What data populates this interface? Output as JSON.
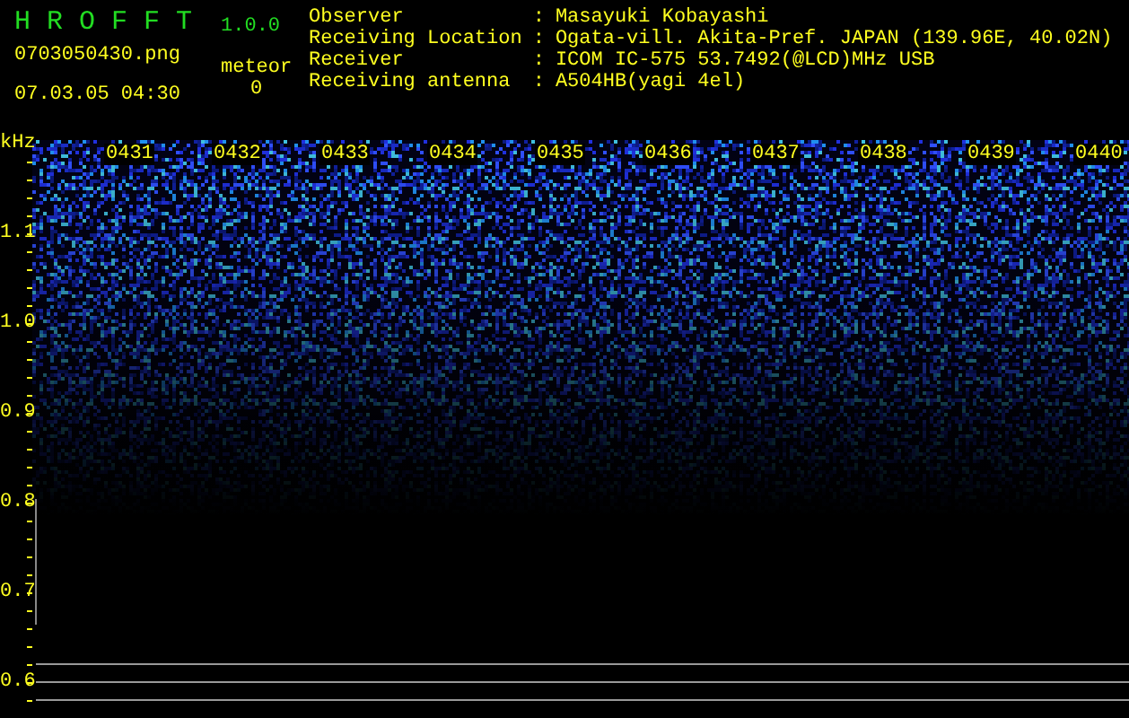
{
  "app": {
    "title": "H R O F F T",
    "version": "1.0.0"
  },
  "file": {
    "name": "0703050430.png",
    "datetime": "07.03.05 04:30"
  },
  "meteor": {
    "label": "meteor",
    "count": "0"
  },
  "station": [
    {
      "label": "Observer",
      "separator": ":",
      "value": "Masayuki Kobayashi"
    },
    {
      "label": "Receiving Location",
      "separator": ":",
      "value": "Ogata-vill. Akita-Pref. JAPAN (139.96E, 40.02N)"
    },
    {
      "label": "Receiver",
      "separator": ":",
      "value": "ICOM IC-575 53.7492(@LCD)MHz USB"
    },
    {
      "label": "Receiving antenna",
      "separator": ":",
      "value": "A504HB(yagi 4el)"
    }
  ],
  "spectrogram": {
    "y_unit": "kHz",
    "y_labels": [
      "1.1",
      "1.0",
      "0.9",
      "0.8",
      "0.7",
      "0.6"
    ],
    "time_labels": [
      "0431",
      "0432",
      "0433",
      "0434",
      "0435",
      "0436",
      "0437",
      "0438",
      "0439",
      "0440"
    ]
  }
}
